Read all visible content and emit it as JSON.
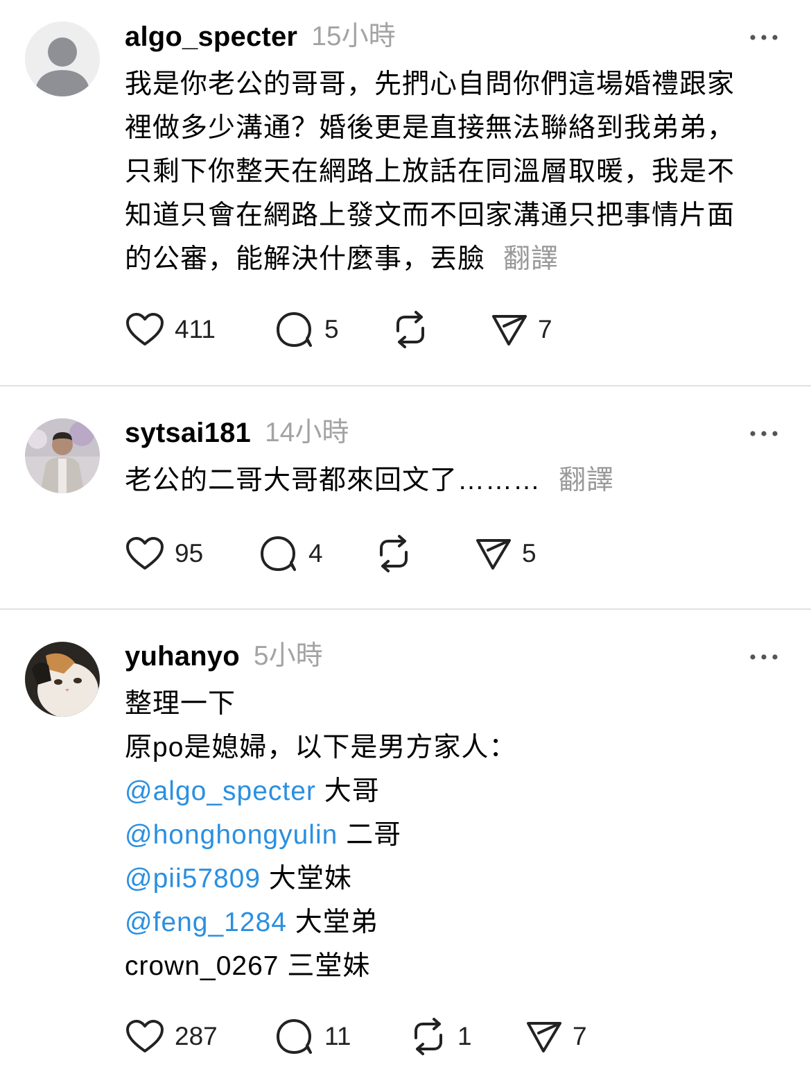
{
  "posts": [
    {
      "username": "algo_specter",
      "time": "15小時",
      "lines": [
        "我是你老公的哥哥，先捫心自問你們這場婚禮跟家",
        "裡做多少溝通？婚後更是直接無法聯絡到我弟弟，",
        "只剩下你整天在網路上放話在同溫層取暖，我是不",
        "知道只會在網路上發文而不回家溝通只把事情片面",
        "的公審，能解決什麼事，丟臉"
      ],
      "translate": "翻譯",
      "likes": "411",
      "comments": "5",
      "reposts": "",
      "shares": "7"
    },
    {
      "username": "sytsai181",
      "time": "14小時",
      "lines": [
        "老公的二哥大哥都來回文了………"
      ],
      "translate": "翻譯",
      "likes": "95",
      "comments": "4",
      "reposts": "",
      "shares": "5"
    },
    {
      "username": "yuhanyo",
      "time": "5小時",
      "lines": [
        "整理一下",
        "原po是媳婦，以下是男方家人："
      ],
      "mentions": [
        {
          "handle": "@algo_specter",
          "role": "大哥"
        },
        {
          "handle": "@honghongyulin",
          "role": "二哥"
        },
        {
          "handle": "@pii57809",
          "role": "大堂妹"
        },
        {
          "handle": "@feng_1284",
          "role": "大堂弟"
        }
      ],
      "last_line": {
        "handle": "crown_0267",
        "role": "三堂妹"
      },
      "likes": "287",
      "comments": "11",
      "reposts": "1",
      "shares": "7"
    }
  ],
  "icons": {
    "like": "heart-icon",
    "comment": "comment-bubble-icon",
    "repost": "repost-icon",
    "share": "send-icon",
    "more": "more-dots-icon"
  },
  "colors": {
    "mention": "#2a8fe0",
    "muted": "#a3a3a3",
    "divider": "#e1e1e1"
  }
}
